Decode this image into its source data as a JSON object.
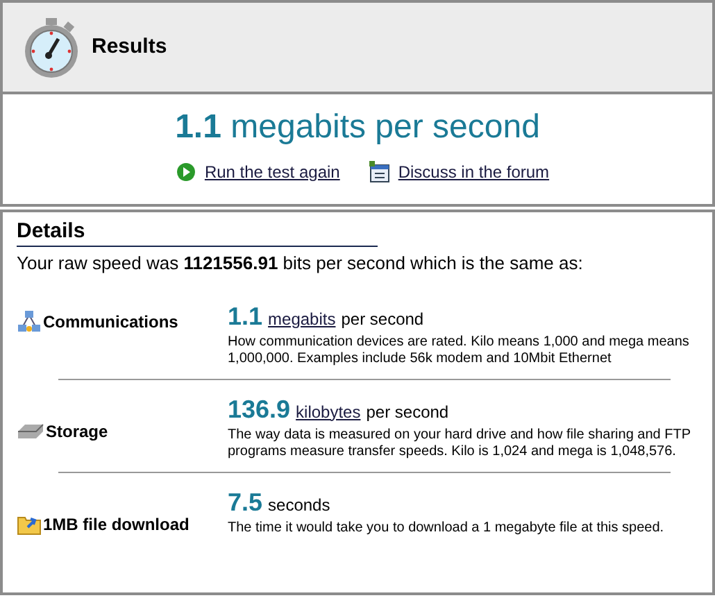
{
  "header": {
    "title": "Results"
  },
  "summary": {
    "value": "1.1",
    "unit": "megabits per second"
  },
  "links": [
    {
      "kind": "play",
      "label": "Run the test again"
    },
    {
      "kind": "forum",
      "label": "Discuss in the forum"
    }
  ],
  "details": {
    "title": "Details",
    "raw_speed": "Your raw speed was **1121556.91** bits per second which is the same as:",
    "rows": [
      {
        "kind": "network",
        "label": "Communications",
        "value": "1.1",
        "unit": "megabits",
        "unit_link": true,
        "suffix": "per second",
        "description": "How communication devices are rated. Kilo means 1,000 and mega means 1,000,000. Examples include 56k modem and 10Mbit Ethernet"
      },
      {
        "kind": "disk",
        "label": "Storage",
        "value": "136.9",
        "unit": "kilobytes",
        "unit_link": true,
        "suffix": "per second",
        "description": "The way data is measured on your hard drive and how file sharing and FTP programs measure transfer speeds. Kilo is 1,024 and mega is 1,048,576."
      },
      {
        "kind": "folder",
        "label": "1MB file download",
        "value": "7.5",
        "unit": "seconds",
        "unit_link": false,
        "description": "The time it would take you to download a 1 megabyte file at this speed."
      }
    ]
  }
}
